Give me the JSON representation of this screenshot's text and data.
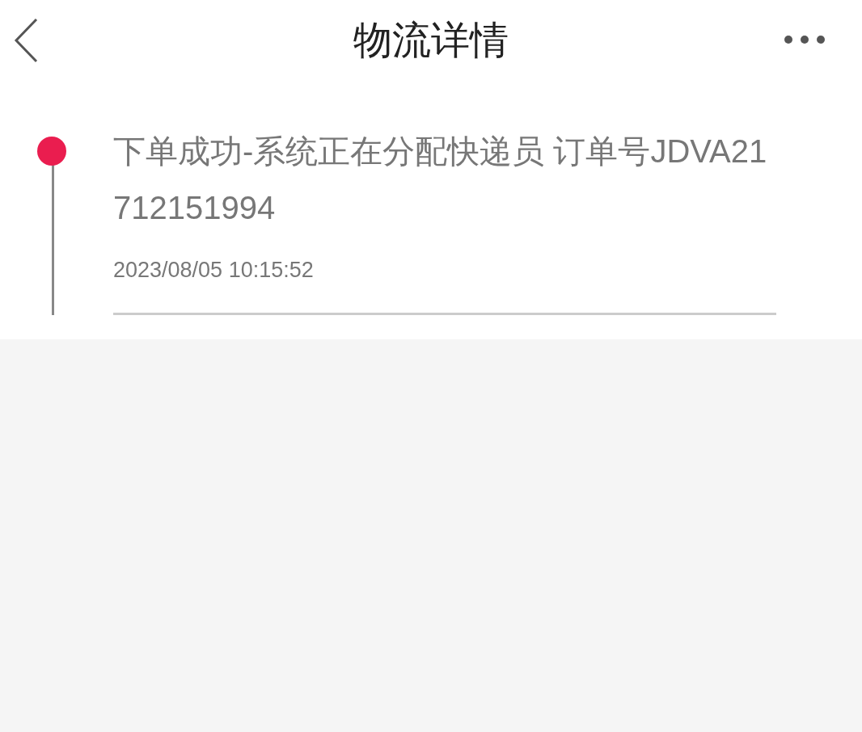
{
  "header": {
    "title": "物流详情"
  },
  "events": [
    {
      "status": "下单成功-系统正在分配快递员 订单号JDVA21712151994",
      "time": "2023/08/05 10:15:52",
      "current": true
    }
  ]
}
